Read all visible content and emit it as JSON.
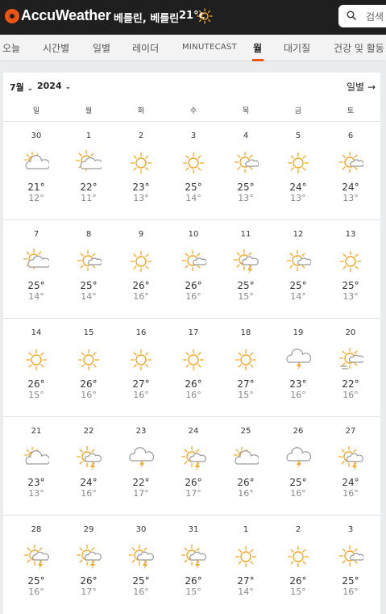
{
  "header": {
    "brand": "AccuWeather",
    "location": "베를린, 베를린",
    "temp": "21°c",
    "search_placeholder": "검색"
  },
  "tabs": [
    "오늘",
    "시간별",
    "일별",
    "레이더",
    "MINUTECAST",
    "월",
    "대기질",
    "건강 및 활동"
  ],
  "calendar": {
    "month": "7월",
    "year": "2024",
    "daily_link": "일별",
    "weekdays": [
      "일",
      "월",
      "화",
      "수",
      "목",
      "금",
      "토"
    ],
    "weeks": [
      [
        {
          "d": "30",
          "hi": "21°",
          "lo": "12°",
          "icon": "partly-cloudy-sun-icon"
        },
        {
          "d": "1",
          "hi": "22°",
          "lo": "11°",
          "icon": "mostly-cloudy-sun-icon"
        },
        {
          "d": "2",
          "hi": "23°",
          "lo": "13°",
          "icon": "sun-icon"
        },
        {
          "d": "3",
          "hi": "25°",
          "lo": "14°",
          "icon": "sun-icon"
        },
        {
          "d": "4",
          "hi": "25°",
          "lo": "13°",
          "icon": "sun-small-cloud-icon"
        },
        {
          "d": "5",
          "hi": "24°",
          "lo": "13°",
          "icon": "sun-icon"
        },
        {
          "d": "6",
          "hi": "24°",
          "lo": "13°",
          "icon": "sun-small-cloud-icon"
        }
      ],
      [
        {
          "d": "7",
          "hi": "25°",
          "lo": "14°",
          "icon": "mostly-cloudy-sun-icon"
        },
        {
          "d": "8",
          "hi": "25°",
          "lo": "14°",
          "icon": "sun-small-cloud-icon"
        },
        {
          "d": "9",
          "hi": "26°",
          "lo": "16°",
          "icon": "sun-icon"
        },
        {
          "d": "10",
          "hi": "26°",
          "lo": "16°",
          "icon": "sun-small-cloud-icon"
        },
        {
          "d": "11",
          "hi": "25°",
          "lo": "15°",
          "icon": "sun-thunderstorm-icon"
        },
        {
          "d": "12",
          "hi": "25°",
          "lo": "14°",
          "icon": "sun-small-cloud-icon"
        },
        {
          "d": "13",
          "hi": "25°",
          "lo": "13°",
          "icon": "sun-icon"
        }
      ],
      [
        {
          "d": "14",
          "hi": "26°",
          "lo": "15°",
          "icon": "sun-icon"
        },
        {
          "d": "15",
          "hi": "26°",
          "lo": "16°",
          "icon": "sun-icon"
        },
        {
          "d": "16",
          "hi": "27°",
          "lo": "16°",
          "icon": "sun-icon"
        },
        {
          "d": "17",
          "hi": "26°",
          "lo": "16°",
          "icon": "sun-icon"
        },
        {
          "d": "18",
          "hi": "27°",
          "lo": "15°",
          "icon": "sun-icon"
        },
        {
          "d": "19",
          "hi": "23°",
          "lo": "16°",
          "icon": "thunderstorm-cloud-icon"
        },
        {
          "d": "20",
          "hi": "22°",
          "lo": "16°",
          "icon": "sun-haze-icon"
        }
      ],
      [
        {
          "d": "21",
          "hi": "23°",
          "lo": "13°",
          "icon": "partly-cloudy-sun-icon"
        },
        {
          "d": "22",
          "hi": "24°",
          "lo": "16°",
          "icon": "sun-thunderstorm-icon"
        },
        {
          "d": "23",
          "hi": "22°",
          "lo": "17°",
          "icon": "thunderstorm-cloud-icon"
        },
        {
          "d": "24",
          "hi": "26°",
          "lo": "17°",
          "icon": "sun-thunderstorm-icon"
        },
        {
          "d": "25",
          "hi": "26°",
          "lo": "16°",
          "icon": "partly-cloudy-sun-icon"
        },
        {
          "d": "26",
          "hi": "25°",
          "lo": "16°",
          "icon": "thunderstorm-cloud-icon"
        },
        {
          "d": "27",
          "hi": "24°",
          "lo": "16°",
          "icon": "sun-thunderstorm-icon"
        }
      ],
      [
        {
          "d": "28",
          "hi": "25°",
          "lo": "16°",
          "icon": "sun-thunderstorm-icon"
        },
        {
          "d": "29",
          "hi": "26°",
          "lo": "17°",
          "icon": "sun-thunderstorm-icon"
        },
        {
          "d": "30",
          "hi": "25°",
          "lo": "16°",
          "icon": "sun-thunderstorm-icon"
        },
        {
          "d": "31",
          "hi": "26°",
          "lo": "15°",
          "icon": "sun-thunderstorm-icon"
        },
        {
          "d": "1",
          "hi": "27°",
          "lo": "14°",
          "icon": "sun-icon"
        },
        {
          "d": "2",
          "hi": "26°",
          "lo": "15°",
          "icon": "sun-icon"
        },
        {
          "d": "3",
          "hi": "25°",
          "lo": "16°",
          "icon": "sun-small-cloud-icon"
        }
      ]
    ]
  },
  "colors": {
    "accent": "#f05514",
    "sun": "#f5a623",
    "topbar": "#1f1f1f",
    "cloud_stroke": "#9a9a9a"
  }
}
